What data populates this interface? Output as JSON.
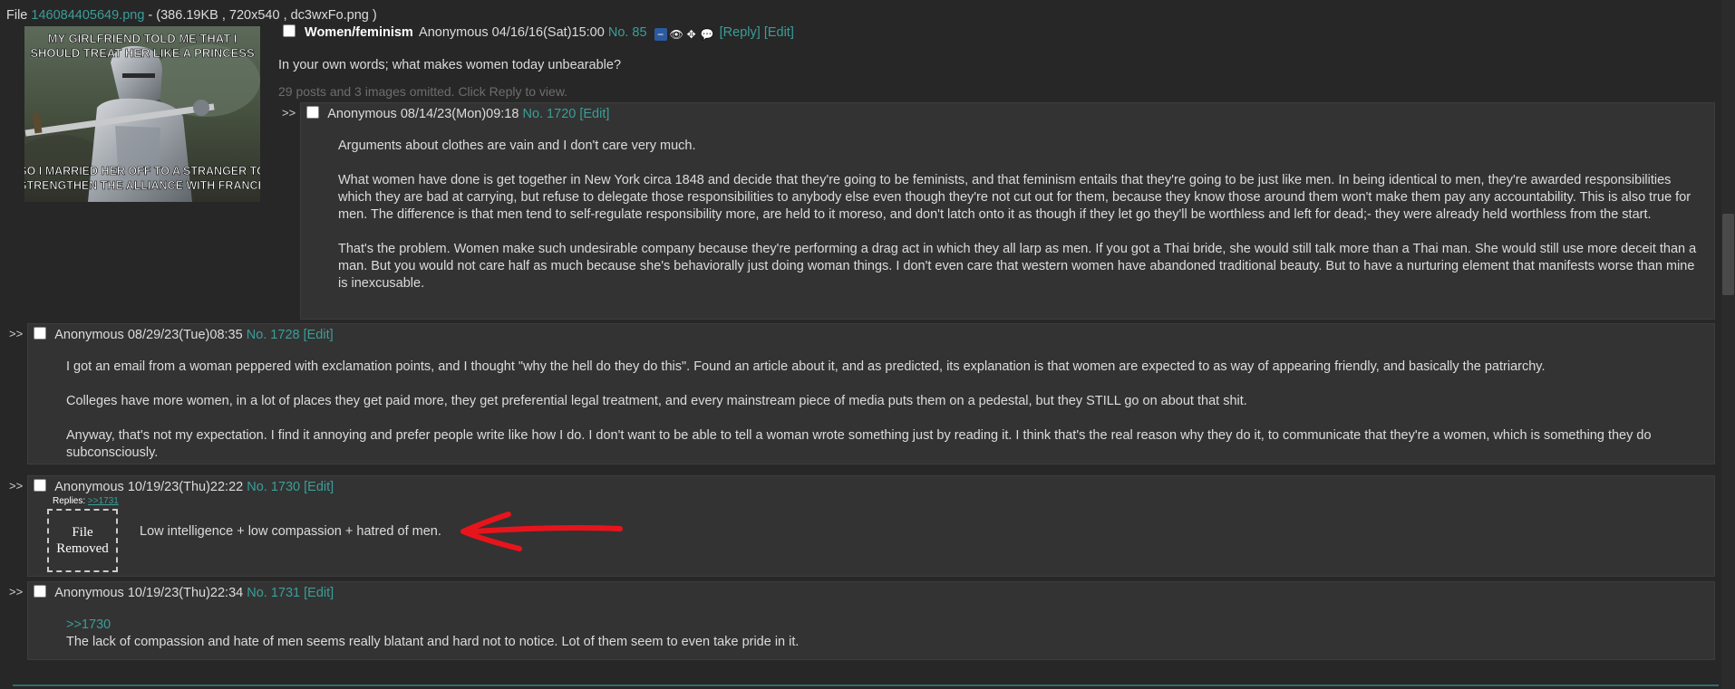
{
  "file_info": {
    "prefix": "File ",
    "filename": "146084405649.png",
    "details": " - (386.19KB , 720x540 , dc3wxFo.png )"
  },
  "op": {
    "image": {
      "caption_top": "MY GIRLFRIEND TOLD ME THAT I SHOULD TREAT HER LIKE A PRINCESS",
      "caption_bottom": "SO I MARRIED HER OFF TO A STRANGER TO STRENGTHEN THE ALLIANCE WITH FRANCE"
    },
    "subject": "Women/feminism",
    "name": "Anonymous",
    "date": "04/16/16(Sat)15:00",
    "number": "No. 85",
    "reply_label": "[Reply]",
    "edit_label": "[Edit]",
    "body": "In your own words; what makes women today unbearable?",
    "omitted": "29 posts and 3 images omitted. Click Reply to view."
  },
  "replies": [
    {
      "arrows": ">>",
      "name": "Anonymous",
      "date": "08/14/23(Mon)09:18",
      "number": "No. 1720",
      "edit_label": "[Edit]",
      "paragraphs": [
        "Arguments about clothes are vain and I don't care very much.",
        "What women have done is get together in New York circa 1848 and decide that they're going to be feminists, and that feminism entails that they're going to be just like men. In being identical to men, they're awarded responsibilities which they are bad at carrying, but refuse to delegate those responsibilities to anybody else even though they're not cut out for them, because they know those around them won't make them pay any accountability. This is also true for men. The difference is that men tend to self-regulate responsibility more, are held to it moreso, and don't latch onto it as though if they let go they'll be worthless and left for dead;- they were already held worthless from the start.",
        "That's the problem. Women make such undesirable company because they're performing a drag act in which they all larp as men. If you got a Thai bride, she would still talk more than a Thai man. She would still use more deceit than a man. But you would not care half as much because she's behaviorally just doing woman things. I don't even care that western women have abandoned traditional beauty. But to have a nurturing element that manifests worse than mine is inexcusable."
      ]
    },
    {
      "arrows": ">>",
      "name": "Anonymous",
      "date": "08/29/23(Tue)08:35",
      "number": "No. 1728",
      "edit_label": "[Edit]",
      "paragraphs": [
        "I got an email from a woman peppered with exclamation points, and I thought \"why the hell do they do this\". Found an article about it, and as predicted, its explanation is that women are expected to as way of appearing friendly, and basically the patriarchy.",
        "Colleges have more women, in a lot of places they get paid more, they get preferential legal treatment, and every mainstream piece of media puts them on a pedestal, but they STILL go on about that shit.",
        "Anyway, that's not my expectation. I find it annoying and prefer people write like how I do. I don't want to be able to tell a woman wrote something just by reading it. I think that's the real reason why they do it, to communicate that they're a women, which is something they do subconsciously."
      ]
    },
    {
      "arrows": ">>",
      "name": "Anonymous",
      "date": "10/19/23(Thu)22:22",
      "number": "No. 1730",
      "edit_label": "[Edit]",
      "replies_label": "Replies:",
      "replies_link": ">>1731",
      "file_removed": [
        "File",
        "Removed"
      ],
      "body": "Low intelligence + low compassion + hatred of men."
    },
    {
      "arrows": ">>",
      "name": "Anonymous",
      "date": "10/19/23(Thu)22:34",
      "number": "No. 1731",
      "edit_label": "[Edit]",
      "quote": ">>1730",
      "body": "The lack of compassion and hate of men seems really blatant and hard not to notice. Lot of them seem to even take pride in it."
    }
  ],
  "icons": [
    "minus-icon",
    "eye-icon",
    "expand-icon",
    "comment-icon",
    "red-arrow-annotation"
  ],
  "colors": {
    "background": "#272727",
    "post_background": "#333333",
    "link": "#3a9e98",
    "annotation_red": "#e8141c"
  }
}
